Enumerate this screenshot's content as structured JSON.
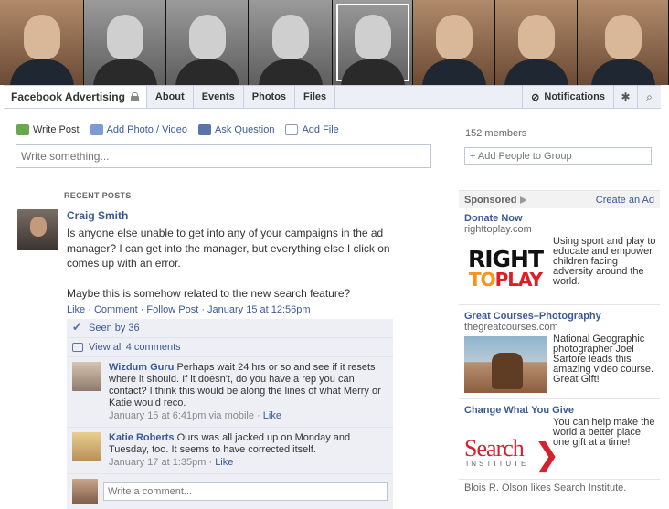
{
  "cover": {
    "photos": [
      {
        "style": "color",
        "width": 92
      },
      {
        "style": "bw",
        "width": 90
      },
      {
        "style": "bw",
        "width": 90
      },
      {
        "style": "bw",
        "width": 92
      },
      {
        "style": "bw",
        "width": 88,
        "selected": true
      },
      {
        "style": "color",
        "width": 90
      },
      {
        "style": "color",
        "width": 90
      },
      {
        "style": "color",
        "width": 100
      }
    ]
  },
  "tabs": {
    "group_title": "Facebook Advertising",
    "items": [
      "About",
      "Events",
      "Photos",
      "Files"
    ],
    "notifications": "Notifications"
  },
  "composer": {
    "actions": [
      "Write Post",
      "Add Photo / Video",
      "Ask Question",
      "Add File"
    ],
    "placeholder": "Write something..."
  },
  "feed": {
    "section_label": "RECENT POSTS",
    "post": {
      "author": "Craig Smith",
      "body_lines": [
        "Is anyone else unable to get into any of your campaigns in the ad manager? I can get into the manager, but everything else I click on comes up with an error.",
        "Maybe this is somehow related to the new search feature?"
      ],
      "actions": "Like · Comment · Follow Post · January 15 at 12:56pm",
      "seen_by": "Seen by 36",
      "view_comments": "View all 4 comments",
      "comments": [
        {
          "author": "Wizdum Guru",
          "text": "Perhaps wait 24 hrs or so and see if it resets where it should. If it doesn't, do you have a rep you can contact? I think this would be along the lines of what Merry or Katie would reco.",
          "meta": "January 15 at 6:41pm via mobile · ",
          "like": "Like"
        },
        {
          "author": "Katie Roberts",
          "text": "Ours was all jacked up on Monday and Tuesday, too. It seems to have corrected itself.",
          "meta": "January 17 at 1:35pm · ",
          "like": "Like"
        }
      ],
      "write_comment_placeholder": "Write a comment..."
    }
  },
  "sidebar": {
    "members": "152 members",
    "add_people": "+ Add People to Group",
    "sponsored": "Sponsored",
    "create_ad": "Create an Ad",
    "ads": [
      {
        "title": "Donate Now",
        "domain": "righttoplay.com",
        "logo_line1": "RIGHT",
        "logo_line2a": "TO",
        "logo_line2b": "PLAY",
        "copy": "Using sport and play to educate and empower children facing adversity around the world."
      },
      {
        "title": "Great Courses–Photography",
        "domain": "thegreatcourses.com",
        "copy": "National Geographic photographer Joel Sartore leads this amazing video course. Great Gift!"
      },
      {
        "title": "Change What You Give",
        "logo_main": "Search",
        "logo_sub": "INSTITUTE",
        "logo_chevron": "❯",
        "copy": "You can help make the world a better place, one gift at a time!"
      }
    ],
    "social": "Blois R. Olson likes Search Institute."
  }
}
